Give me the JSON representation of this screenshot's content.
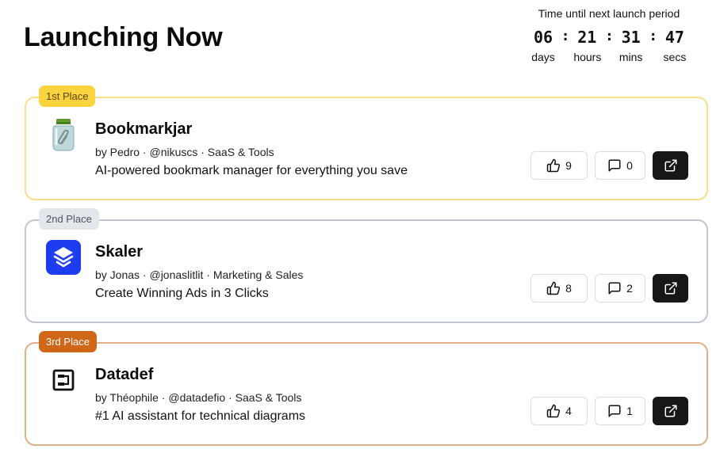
{
  "header": {
    "title": "Launching Now"
  },
  "countdown": {
    "caption": "Time until next launch period",
    "days": "06",
    "hours": "21",
    "mins": "31",
    "secs": "47",
    "days_label": "days",
    "hours_label": "hours",
    "mins_label": "mins",
    "secs_label": "secs",
    "separator": ":"
  },
  "launches": [
    {
      "rank_label": "1st Place",
      "name": "Bookmarkjar",
      "meta": "by Pedro · @nikuscs · SaaS & Tools",
      "description": "AI-powered bookmark manager for everything you save",
      "votes": "9",
      "comments": "0",
      "logo_icon": "jar-icon"
    },
    {
      "rank_label": "2nd Place",
      "name": "Skaler",
      "meta": "by Jonas · @jonaslitlit · Marketing & Sales",
      "description": "Create Winning Ads in 3 Clicks",
      "votes": "8",
      "comments": "2",
      "logo_icon": "layers-icon"
    },
    {
      "rank_label": "3rd Place",
      "name": "Datadef",
      "meta": "by Théophile · @datadefio · SaaS & Tools",
      "description": "#1 AI assistant for technical diagrams",
      "votes": "4",
      "comments": "1",
      "logo_icon": "diagram-icon"
    }
  ],
  "colors": {
    "gold_border": "#f7e08a",
    "gold_badge": "#fbd33f",
    "silver_border": "#c0c7d3",
    "silver_badge": "#e3e6eb",
    "bronze_border": "#e0b08a",
    "bronze_badge": "#cf6618",
    "visit_button": "#171717",
    "skaler_brand": "#1d3cf0"
  }
}
